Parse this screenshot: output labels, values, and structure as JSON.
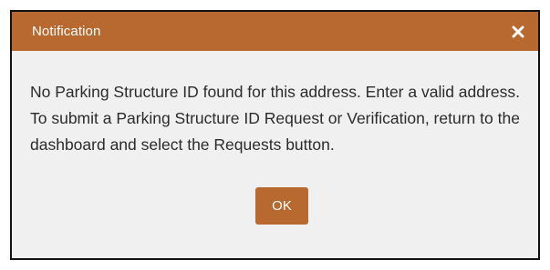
{
  "dialog": {
    "title": "Notification",
    "close_icon": "close-icon",
    "message": "No Parking Structure ID found for this address. Enter a valid address. To submit a Parking Structure ID Request or Verification, return to the dashboard and select the Requests button.",
    "ok_label": "OK"
  },
  "colors": {
    "header": "#b8692f",
    "body_background": "#f0f0f0",
    "button": "#b8692f",
    "text": "#2b2b2b"
  }
}
